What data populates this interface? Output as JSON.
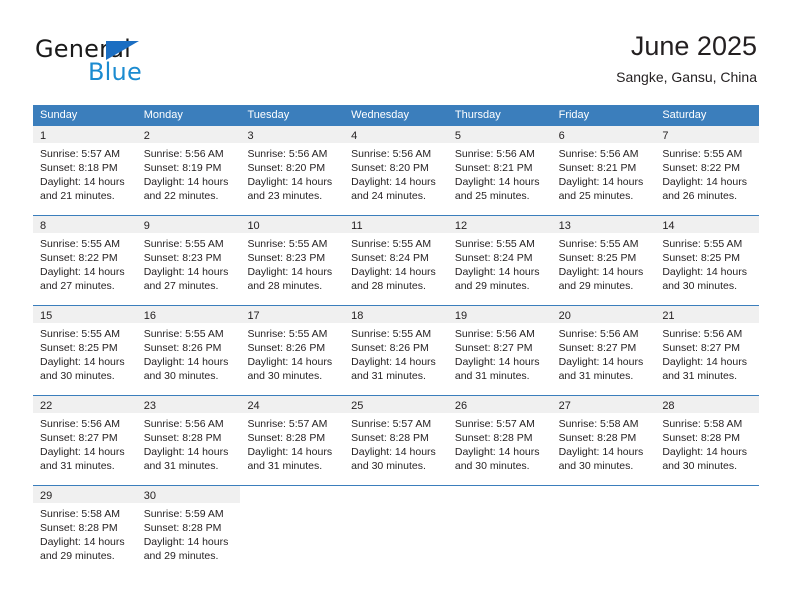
{
  "brand": {
    "name_top": "General",
    "name_bottom": "Blue",
    "triangle_icon": "triangle-icon",
    "colors": {
      "top_text": "#1a1a1a",
      "bottom_text": "#1b8bd0",
      "triangle": "#1b6ec2"
    }
  },
  "header": {
    "title": "June 2025",
    "subtitle": "Sangke, Gansu, China"
  },
  "calendar": {
    "accent_color": "#3b7ebc",
    "daynum_background": "#f0f0f0",
    "weekdays": [
      "Sunday",
      "Monday",
      "Tuesday",
      "Wednesday",
      "Thursday",
      "Friday",
      "Saturday"
    ],
    "weeks": [
      [
        {
          "day": "1",
          "sunrise": "Sunrise: 5:57 AM",
          "sunset": "Sunset: 8:18 PM",
          "daylight_line1": "Daylight: 14 hours",
          "daylight_line2": "and 21 minutes."
        },
        {
          "day": "2",
          "sunrise": "Sunrise: 5:56 AM",
          "sunset": "Sunset: 8:19 PM",
          "daylight_line1": "Daylight: 14 hours",
          "daylight_line2": "and 22 minutes."
        },
        {
          "day": "3",
          "sunrise": "Sunrise: 5:56 AM",
          "sunset": "Sunset: 8:20 PM",
          "daylight_line1": "Daylight: 14 hours",
          "daylight_line2": "and 23 minutes."
        },
        {
          "day": "4",
          "sunrise": "Sunrise: 5:56 AM",
          "sunset": "Sunset: 8:20 PM",
          "daylight_line1": "Daylight: 14 hours",
          "daylight_line2": "and 24 minutes."
        },
        {
          "day": "5",
          "sunrise": "Sunrise: 5:56 AM",
          "sunset": "Sunset: 8:21 PM",
          "daylight_line1": "Daylight: 14 hours",
          "daylight_line2": "and 25 minutes."
        },
        {
          "day": "6",
          "sunrise": "Sunrise: 5:56 AM",
          "sunset": "Sunset: 8:21 PM",
          "daylight_line1": "Daylight: 14 hours",
          "daylight_line2": "and 25 minutes."
        },
        {
          "day": "7",
          "sunrise": "Sunrise: 5:55 AM",
          "sunset": "Sunset: 8:22 PM",
          "daylight_line1": "Daylight: 14 hours",
          "daylight_line2": "and 26 minutes."
        }
      ],
      [
        {
          "day": "8",
          "sunrise": "Sunrise: 5:55 AM",
          "sunset": "Sunset: 8:22 PM",
          "daylight_line1": "Daylight: 14 hours",
          "daylight_line2": "and 27 minutes."
        },
        {
          "day": "9",
          "sunrise": "Sunrise: 5:55 AM",
          "sunset": "Sunset: 8:23 PM",
          "daylight_line1": "Daylight: 14 hours",
          "daylight_line2": "and 27 minutes."
        },
        {
          "day": "10",
          "sunrise": "Sunrise: 5:55 AM",
          "sunset": "Sunset: 8:23 PM",
          "daylight_line1": "Daylight: 14 hours",
          "daylight_line2": "and 28 minutes."
        },
        {
          "day": "11",
          "sunrise": "Sunrise: 5:55 AM",
          "sunset": "Sunset: 8:24 PM",
          "daylight_line1": "Daylight: 14 hours",
          "daylight_line2": "and 28 minutes."
        },
        {
          "day": "12",
          "sunrise": "Sunrise: 5:55 AM",
          "sunset": "Sunset: 8:24 PM",
          "daylight_line1": "Daylight: 14 hours",
          "daylight_line2": "and 29 minutes."
        },
        {
          "day": "13",
          "sunrise": "Sunrise: 5:55 AM",
          "sunset": "Sunset: 8:25 PM",
          "daylight_line1": "Daylight: 14 hours",
          "daylight_line2": "and 29 minutes."
        },
        {
          "day": "14",
          "sunrise": "Sunrise: 5:55 AM",
          "sunset": "Sunset: 8:25 PM",
          "daylight_line1": "Daylight: 14 hours",
          "daylight_line2": "and 30 minutes."
        }
      ],
      [
        {
          "day": "15",
          "sunrise": "Sunrise: 5:55 AM",
          "sunset": "Sunset: 8:25 PM",
          "daylight_line1": "Daylight: 14 hours",
          "daylight_line2": "and 30 minutes."
        },
        {
          "day": "16",
          "sunrise": "Sunrise: 5:55 AM",
          "sunset": "Sunset: 8:26 PM",
          "daylight_line1": "Daylight: 14 hours",
          "daylight_line2": "and 30 minutes."
        },
        {
          "day": "17",
          "sunrise": "Sunrise: 5:55 AM",
          "sunset": "Sunset: 8:26 PM",
          "daylight_line1": "Daylight: 14 hours",
          "daylight_line2": "and 30 minutes."
        },
        {
          "day": "18",
          "sunrise": "Sunrise: 5:55 AM",
          "sunset": "Sunset: 8:26 PM",
          "daylight_line1": "Daylight: 14 hours",
          "daylight_line2": "and 31 minutes."
        },
        {
          "day": "19",
          "sunrise": "Sunrise: 5:56 AM",
          "sunset": "Sunset: 8:27 PM",
          "daylight_line1": "Daylight: 14 hours",
          "daylight_line2": "and 31 minutes."
        },
        {
          "day": "20",
          "sunrise": "Sunrise: 5:56 AM",
          "sunset": "Sunset: 8:27 PM",
          "daylight_line1": "Daylight: 14 hours",
          "daylight_line2": "and 31 minutes."
        },
        {
          "day": "21",
          "sunrise": "Sunrise: 5:56 AM",
          "sunset": "Sunset: 8:27 PM",
          "daylight_line1": "Daylight: 14 hours",
          "daylight_line2": "and 31 minutes."
        }
      ],
      [
        {
          "day": "22",
          "sunrise": "Sunrise: 5:56 AM",
          "sunset": "Sunset: 8:27 PM",
          "daylight_line1": "Daylight: 14 hours",
          "daylight_line2": "and 31 minutes."
        },
        {
          "day": "23",
          "sunrise": "Sunrise: 5:56 AM",
          "sunset": "Sunset: 8:28 PM",
          "daylight_line1": "Daylight: 14 hours",
          "daylight_line2": "and 31 minutes."
        },
        {
          "day": "24",
          "sunrise": "Sunrise: 5:57 AM",
          "sunset": "Sunset: 8:28 PM",
          "daylight_line1": "Daylight: 14 hours",
          "daylight_line2": "and 31 minutes."
        },
        {
          "day": "25",
          "sunrise": "Sunrise: 5:57 AM",
          "sunset": "Sunset: 8:28 PM",
          "daylight_line1": "Daylight: 14 hours",
          "daylight_line2": "and 30 minutes."
        },
        {
          "day": "26",
          "sunrise": "Sunrise: 5:57 AM",
          "sunset": "Sunset: 8:28 PM",
          "daylight_line1": "Daylight: 14 hours",
          "daylight_line2": "and 30 minutes."
        },
        {
          "day": "27",
          "sunrise": "Sunrise: 5:58 AM",
          "sunset": "Sunset: 8:28 PM",
          "daylight_line1": "Daylight: 14 hours",
          "daylight_line2": "and 30 minutes."
        },
        {
          "day": "28",
          "sunrise": "Sunrise: 5:58 AM",
          "sunset": "Sunset: 8:28 PM",
          "daylight_line1": "Daylight: 14 hours",
          "daylight_line2": "and 30 minutes."
        }
      ],
      [
        {
          "day": "29",
          "sunrise": "Sunrise: 5:58 AM",
          "sunset": "Sunset: 8:28 PM",
          "daylight_line1": "Daylight: 14 hours",
          "daylight_line2": "and 29 minutes."
        },
        {
          "day": "30",
          "sunrise": "Sunrise: 5:59 AM",
          "sunset": "Sunset: 8:28 PM",
          "daylight_line1": "Daylight: 14 hours",
          "daylight_line2": "and 29 minutes."
        },
        {
          "day": "",
          "sunrise": "",
          "sunset": "",
          "daylight_line1": "",
          "daylight_line2": ""
        },
        {
          "day": "",
          "sunrise": "",
          "sunset": "",
          "daylight_line1": "",
          "daylight_line2": ""
        },
        {
          "day": "",
          "sunrise": "",
          "sunset": "",
          "daylight_line1": "",
          "daylight_line2": ""
        },
        {
          "day": "",
          "sunrise": "",
          "sunset": "",
          "daylight_line1": "",
          "daylight_line2": ""
        },
        {
          "day": "",
          "sunrise": "",
          "sunset": "",
          "daylight_line1": "",
          "daylight_line2": ""
        }
      ]
    ]
  }
}
